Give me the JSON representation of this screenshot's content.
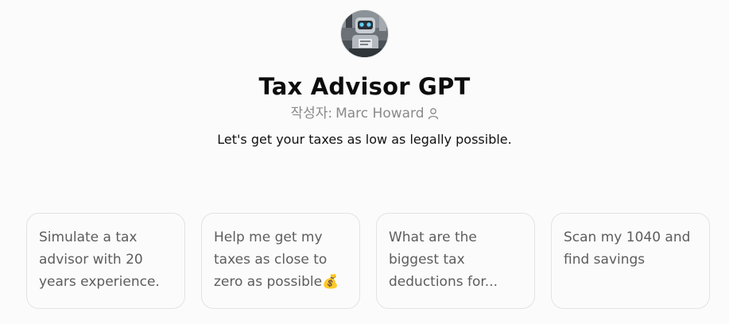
{
  "gpt": {
    "name": "Tax Advisor GPT",
    "author_prefix": "작성자:",
    "author_name": "Marc Howard",
    "author_icon": "person-icon",
    "description": "Let's get your taxes as low as legally possible.",
    "avatar_icon": "robot-avatar-icon"
  },
  "prompts": [
    {
      "label": "Simulate a tax advisor with 20 years experience."
    },
    {
      "label": "Help me get my taxes as close to zero as possible💰"
    },
    {
      "label": "What are the biggest tax deductions for..."
    },
    {
      "label": "Scan my 1040 and find savings"
    }
  ]
}
